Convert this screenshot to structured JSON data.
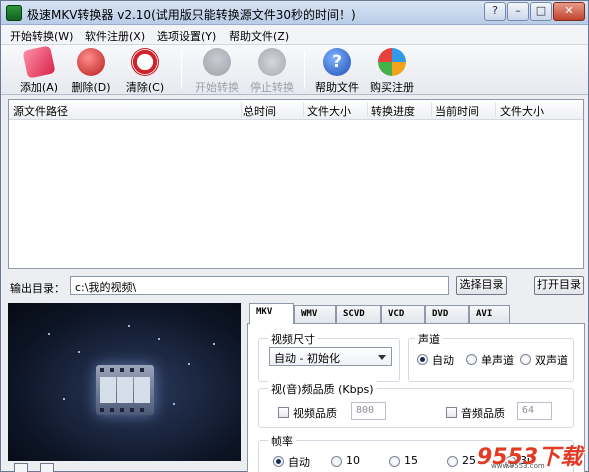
{
  "window": {
    "title": "极速MKV转换器 v2.10(试用版只能转换源文件30秒的时间！)",
    "btn_help": "?",
    "btn_minimize": "–",
    "btn_maximize": "□",
    "btn_close": "✕"
  },
  "menu": [
    "开始转换(W)",
    "软件注册(X)",
    "选项设置(Y)",
    "帮助文件(Z)"
  ],
  "toolbar": {
    "add": "添加(A)",
    "delete": "删除(D)",
    "clear": "清除(C)",
    "start": "开始转换",
    "stop": "停止转换",
    "help": "帮助文件",
    "buy": "购买注册"
  },
  "list": {
    "columns": [
      "源文件路径",
      "总时间",
      "文件大小",
      "转换进度",
      "当前时间",
      "文件大小"
    ]
  },
  "output": {
    "label": "输出目录：",
    "path": "c:\\我的视频\\",
    "choose_btn": "选择目录",
    "open_btn": "打开目录"
  },
  "tabs": [
    "MKV",
    "WMV",
    "SCVD",
    "VCD",
    "DVD",
    "AVI"
  ],
  "settings": {
    "video_size_title": "视频尺寸",
    "video_size_value": "自动 - 初始化",
    "channel_title": "声道",
    "channel_options": [
      "自动",
      "单声道",
      "双声道"
    ],
    "quality_title": "视(音)频品质 (Kbps)",
    "video_quality_label": "视频品质",
    "video_quality_value": "800",
    "audio_quality_label": "音频品质",
    "audio_quality_value": "64",
    "framerate_title": "帧率",
    "framerate_options": [
      "自动",
      "10",
      "15",
      "25",
      "30"
    ]
  },
  "watermark": {
    "text": "9553下载",
    "sub": "www.9553.com"
  },
  "colors": {
    "title_gradient_top": "#d8e4f3",
    "close_button": "#c0432c",
    "watermark": "#e23a25"
  }
}
